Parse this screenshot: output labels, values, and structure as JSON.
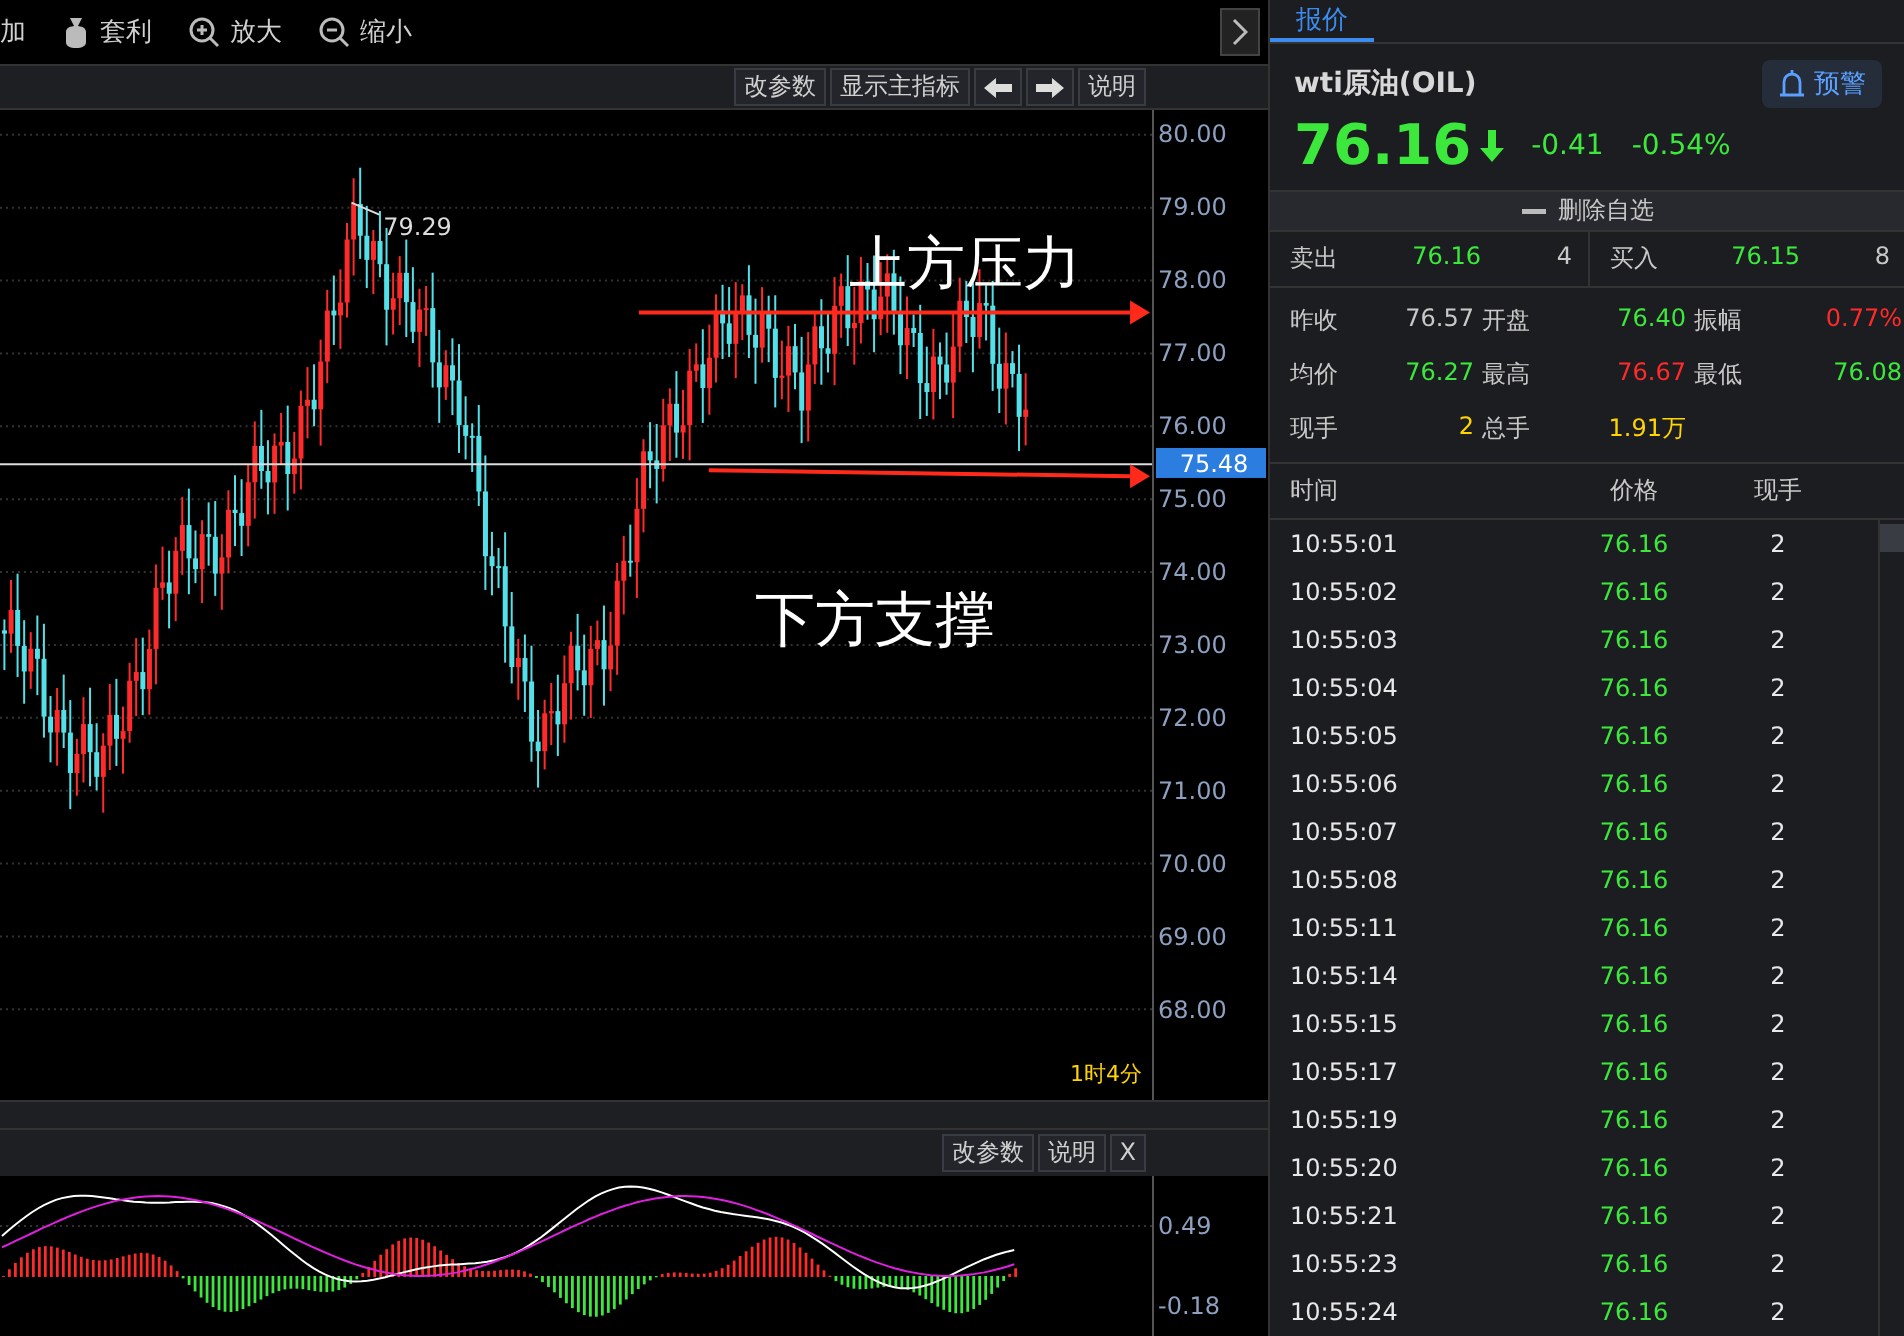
{
  "toolbar": {
    "items": [
      {
        "kind": "plain",
        "label": "加"
      },
      {
        "kind": "moneybag",
        "label": "套利"
      },
      {
        "kind": "zoom-in",
        "label": "放大"
      },
      {
        "kind": "zoom-out",
        "label": "缩小"
      }
    ]
  },
  "chart_toolbar": {
    "buttons": [
      {
        "kind": "text",
        "label": "改参数"
      },
      {
        "kind": "text",
        "label": "显示主指标"
      },
      {
        "kind": "left-arrow"
      },
      {
        "kind": "right-arrow"
      },
      {
        "kind": "text",
        "label": "说明"
      }
    ]
  },
  "main_chart": {
    "y_axis_labels": [
      "80.00",
      "79.00",
      "78.00",
      "77.00",
      "76.00",
      "75.00",
      "74.00",
      "73.00",
      "72.00",
      "71.00",
      "70.00",
      "69.00",
      "68.00"
    ],
    "current_price_tag": "75.48",
    "high_label": "79.29",
    "timer": "1时4分",
    "annotations": [
      {
        "kind": "resistance",
        "text": "上方压力"
      },
      {
        "kind": "support",
        "text": "下方支撑"
      }
    ]
  },
  "indicator_toolbar": {
    "buttons": [
      "改参数",
      "说明",
      "X"
    ]
  },
  "indicator_chart": {
    "y_axis_labels": [
      "0.49",
      "-0.18"
    ]
  },
  "quote_panel": {
    "tabs": [
      {
        "label": "报价",
        "selected": true
      }
    ],
    "instrument": "wti原油(OIL)",
    "alert_button": "预警",
    "price": "76.16",
    "falling": true,
    "change": "-0.41",
    "change_pct": "-0.54%",
    "watchlist_button": "删除自选",
    "order_book": [
      {
        "label": "卖出",
        "price": "76.16",
        "volume": "4"
      },
      {
        "label": "买入",
        "price": "76.15",
        "volume": "8"
      }
    ],
    "stats": [
      {
        "label": "昨收",
        "value": "76.57",
        "color": "#c8c8c8"
      },
      {
        "label": "开盘",
        "value": "76.40",
        "color": "#3ce83c"
      },
      {
        "label": "振幅",
        "value": "0.77%",
        "color": "#ff2a2a"
      },
      {
        "label": "均价",
        "value": "76.27",
        "color": "#3ce83c"
      },
      {
        "label": "最高",
        "value": "76.67",
        "color": "#ff2a2a"
      },
      {
        "label": "最低",
        "value": "76.08",
        "color": "#3ce83c"
      },
      {
        "label": "现手",
        "value": "2",
        "color": "#ffd400"
      },
      {
        "label": "总手",
        "value": "1.91万",
        "color": "#ffd400"
      }
    ],
    "trades": {
      "columns": [
        "时间",
        "价格",
        "现手"
      ],
      "rows": [
        {
          "time": "10:55:01",
          "price": "76.16",
          "volume": "2"
        },
        {
          "time": "10:55:02",
          "price": "76.16",
          "volume": "2"
        },
        {
          "time": "10:55:03",
          "price": "76.16",
          "volume": "2"
        },
        {
          "time": "10:55:04",
          "price": "76.16",
          "volume": "2"
        },
        {
          "time": "10:55:05",
          "price": "76.16",
          "volume": "2"
        },
        {
          "time": "10:55:06",
          "price": "76.16",
          "volume": "2"
        },
        {
          "time": "10:55:07",
          "price": "76.16",
          "volume": "2"
        },
        {
          "time": "10:55:08",
          "price": "76.16",
          "volume": "2"
        },
        {
          "time": "10:55:11",
          "price": "76.16",
          "volume": "2"
        },
        {
          "time": "10:55:14",
          "price": "76.16",
          "volume": "2"
        },
        {
          "time": "10:55:15",
          "price": "76.16",
          "volume": "2"
        },
        {
          "time": "10:55:17",
          "price": "76.16",
          "volume": "2"
        },
        {
          "time": "10:55:19",
          "price": "76.16",
          "volume": "2"
        },
        {
          "time": "10:55:20",
          "price": "76.16",
          "volume": "2"
        },
        {
          "time": "10:55:21",
          "price": "76.16",
          "volume": "2"
        },
        {
          "time": "10:55:23",
          "price": "76.16",
          "volume": "2"
        },
        {
          "time": "10:55:24",
          "price": "76.16",
          "volume": "2"
        }
      ]
    }
  }
}
